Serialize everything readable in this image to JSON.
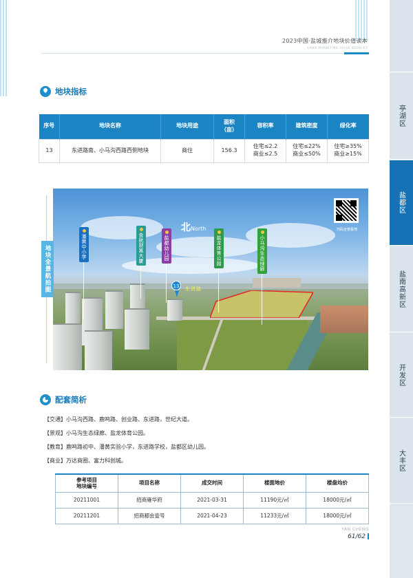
{
  "header": {
    "title": "2023中国·盐城推介地块价值读本",
    "subtitle": "LAND MARKETING VALUE BOOKLET"
  },
  "side_nav": {
    "items": [
      {
        "label": "亭湖区",
        "active": false
      },
      {
        "label": "盐都区",
        "active": true
      },
      {
        "label": "盐南高新区",
        "active": false
      },
      {
        "label": "开发区",
        "active": false
      },
      {
        "label": "大丰区",
        "active": false
      }
    ]
  },
  "section_indicators": {
    "title": "地块指标",
    "headers": [
      "序号",
      "地块名称",
      "地块用途",
      "面积\n（亩）",
      "容积率",
      "建筑密度",
      "绿化率"
    ],
    "row": {
      "no": "13",
      "name": "东进路南、小马沟西路西侧地块",
      "use": "商住",
      "area": "156.3",
      "far": "住宅≤2.2\n商业≤2.5",
      "density": "住宅≤22%\n商业≤50%",
      "green": "住宅≥35%\n商业≥15%"
    }
  },
  "aerial": {
    "tag": "地块全景航拍图",
    "north_char": "北",
    "north_word": "North",
    "pin_number": "13",
    "road_label": "东进路",
    "qr_caption": "扫码全景看地",
    "labels": [
      {
        "text": "潘黄中小学",
        "color": "#1b6fc0"
      },
      {
        "text": "金航财富大厦",
        "color": "#2a9c94"
      },
      {
        "text": "盐都幼儿园",
        "color": "#8b3fa4"
      },
      {
        "text": "盐龙体育公园",
        "color": "#2e9a4c"
      },
      {
        "text": "小马沟生态绿廊",
        "color": "#35a13a"
      }
    ]
  },
  "section_facilities": {
    "title": "配套简析",
    "lines": [
      "【交通】小马沟西路、鹿鸣路、创业路、东进路，世纪大道。",
      "【景观】小马沟生态绿廊、盐龙体育公园。",
      "【教育】鹿鸣路初中、潘黄实验小学，东进路学校，盐都区幼儿园。",
      "【商业】万达商圈、富力科创城。"
    ]
  },
  "ref_table": {
    "headers": [
      "参考项目\n地块编号",
      "项目名称",
      "成交时间",
      "楼面地价",
      "楼盘均价"
    ],
    "rows": [
      [
        "20211001",
        "招商雍华府",
        "2021-03-31",
        "11190元/㎡",
        "18000元/㎡"
      ],
      [
        "20211201",
        "招商都会壹号",
        "2021-04-23",
        "11233元/㎡",
        "18000元/㎡"
      ]
    ]
  },
  "footer": {
    "brand": "YAN CHENG",
    "page": "61/62"
  }
}
